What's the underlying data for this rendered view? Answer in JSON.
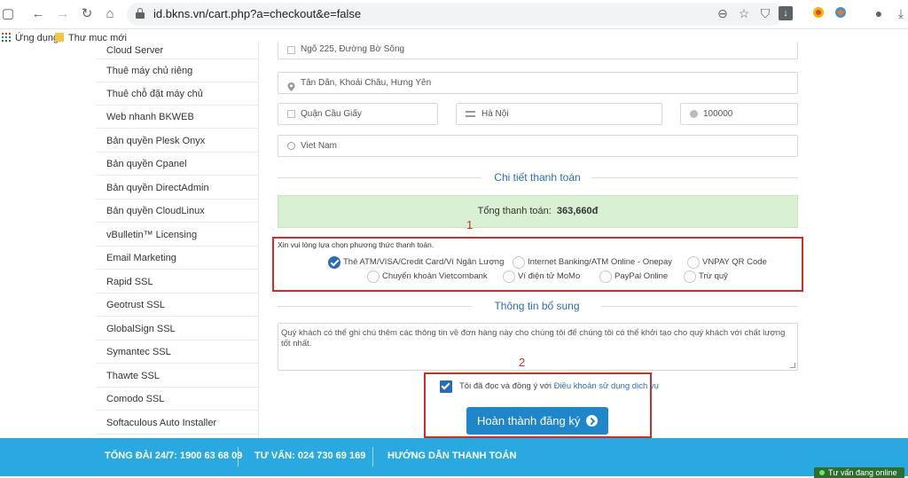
{
  "browser": {
    "url": "id.bkns.vn/cart.php?a=checkout&e=false",
    "bookmarks": [
      "Ứng dụng",
      "Thư mục mới"
    ]
  },
  "sidebar": {
    "items": [
      "Cloud Server",
      "Thuê máy chủ riêng",
      "Thuê chỗ đặt máy chủ",
      "Web nhanh BKWEB",
      "Bản quyền Plesk Onyx",
      "Bản quyền Cpanel",
      "Bản quyền DirectAdmin",
      "Bản quyền CloudLinux",
      "vBulletin™ Licensing",
      "Email Marketing",
      "Rapid SSL",
      "Geotrust SSL",
      "GlobalSign SSL",
      "Symantec SSL",
      "Thawte SSL",
      "Comodo SSL",
      "Softaculous Auto Installer"
    ]
  },
  "address": {
    "street": "Ngõ 225, Đường Bờ Sông",
    "ward": "Tân Dân, Khoái Châu, Hưng Yên",
    "district": "Quận Cầu Giấy",
    "city": "Hà Nội",
    "postcode": "100000",
    "country": "Viet Nam"
  },
  "payment": {
    "section_title": "Chi tiết thanh toán",
    "total_label": "Tổng thanh toán:",
    "total_value": "363,660đ",
    "prompt": "Xin vui lòng lựa chọn phương thức thanh toán.",
    "methods": [
      {
        "label": "Thẻ ATM/VISA/Credit Card/Ví Ngân Lượng",
        "checked": true
      },
      {
        "label": "Internet Banking/ATM Online - Onepay",
        "checked": false
      },
      {
        "label": "VNPAY QR Code",
        "checked": false
      },
      {
        "label": "Chuyển khoản Vietcombank",
        "checked": false
      },
      {
        "label": "Ví điện tử MoMo",
        "checked": false
      },
      {
        "label": "PayPal Online",
        "checked": false
      },
      {
        "label": "Trừ quỹ",
        "checked": false
      }
    ]
  },
  "extra": {
    "section_title": "Thông tin bổ sung",
    "notes_placeholder": "Quý khách có thể ghi chú thêm các thông tin về đơn hàng này cho chúng tôi để chúng tôi có thể khởi tạo cho quý khách với chất lượng tốt nhất."
  },
  "agreement": {
    "text": "Tôi đã đọc và đồng ý với ",
    "link": "Điều khoản sử dụng dịch vụ",
    "checked": true
  },
  "submit_label": "Hoàn thành đăng ký",
  "annotations": {
    "one": "1",
    "two": "2"
  },
  "footer": {
    "hotline": "TỔNG ĐÀI 24/7: 1900 63 68 09",
    "consult": "TƯ VẤN: 024 730 69 169",
    "guide": "HƯỚNG DẪN THANH TOÁN"
  },
  "chat_label": "Tư vấn đang online",
  "colors": {
    "accent": "#2a6db3",
    "footer": "#29a9e0",
    "annotation": "#d42a2a",
    "total_bg": "#d9f0d3"
  }
}
